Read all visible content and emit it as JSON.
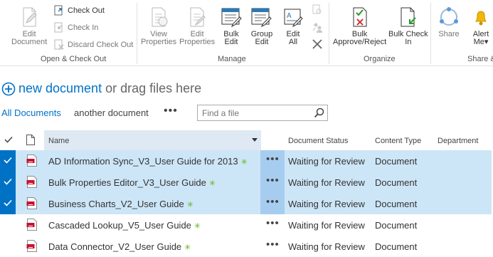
{
  "ribbon": {
    "open_checkout_group": {
      "label": "Open & Check Out",
      "edit_document": "Edit\nDocument",
      "check_out": "Check Out",
      "check_in": "Check In",
      "discard_check_out": "Discard Check Out"
    },
    "manage_group": {
      "label": "Manage",
      "view_properties": "View\nProperties",
      "edit_properties": "Edit\nProperties",
      "bulk_edit": "Bulk\nEdit",
      "group_edit": "Group\nEdit",
      "edit_all": "Edit\nAll"
    },
    "organize_group": {
      "label": "Organize",
      "bulk_approve_reject": "Bulk\nApprove/Reject",
      "bulk_check_in": "Bulk Check\nIn"
    },
    "share_group": {
      "label": "Share &",
      "share": "Share",
      "alert_me": "Alert\nMe▾"
    }
  },
  "new_document": {
    "link": "new document",
    "rest": "or drag files here"
  },
  "views": {
    "all_documents": "All Documents",
    "another_document": "another document",
    "more": "•••"
  },
  "search": {
    "placeholder": "Find a file"
  },
  "list": {
    "headers": {
      "name": "Name",
      "document_status": "Document Status",
      "content_type": "Content Type",
      "department": "Department"
    },
    "rows": [
      {
        "name": "AD Information Sync_V3_User Guide for 2013",
        "new": "✳",
        "dots": "•••",
        "status": "Waiting for Review",
        "content_type": "Document",
        "selected": true
      },
      {
        "name": "Bulk Properties Editor_V3_User Guide",
        "new": "✳",
        "dots": "•••",
        "status": "Waiting for Review",
        "content_type": "Document",
        "selected": true
      },
      {
        "name": "Business Charts_V2_User Guide",
        "new": "✳",
        "dots": "•••",
        "status": "Waiting for Review",
        "content_type": "Document",
        "selected": true
      },
      {
        "name": "Cascaded Lookup_V5_User Guide",
        "new": "✳",
        "dots": "•••",
        "status": "Waiting for Review",
        "content_type": "Document",
        "selected": false
      },
      {
        "name": "Data Connector_V2_User Guide",
        "new": "✳",
        "dots": "•••",
        "status": "Waiting for Review",
        "content_type": "Document",
        "selected": false
      }
    ]
  },
  "colors": {
    "accent": "#0072c6",
    "selected_row": "#cde6f7",
    "header_highlight": "#dfe9f3",
    "new_marker": "#5db317"
  }
}
